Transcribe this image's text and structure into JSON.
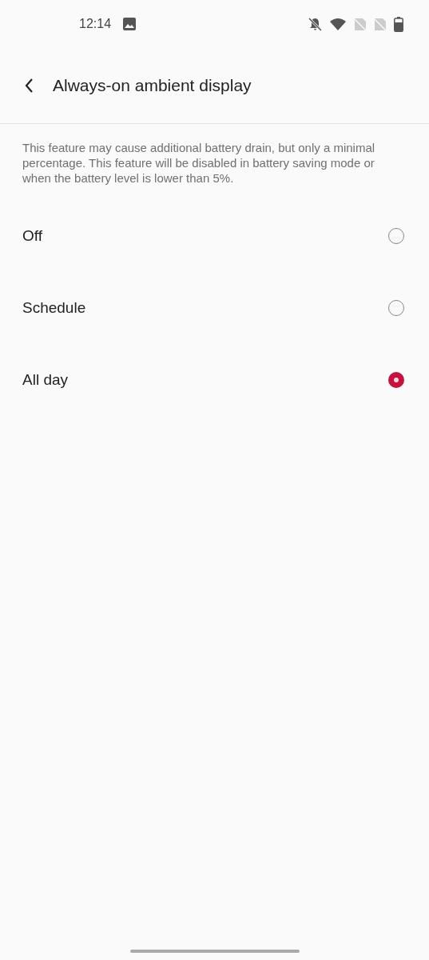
{
  "status_bar": {
    "time": "12:14"
  },
  "header": {
    "title": "Always-on ambient display"
  },
  "description": "This feature may cause additional battery drain, but only a minimal percentage. This feature will be disabled in battery saving mode or when the battery level is lower than 5%.",
  "options": [
    {
      "label": "Off",
      "selected": false
    },
    {
      "label": "Schedule",
      "selected": false
    },
    {
      "label": "All day",
      "selected": true
    }
  ]
}
